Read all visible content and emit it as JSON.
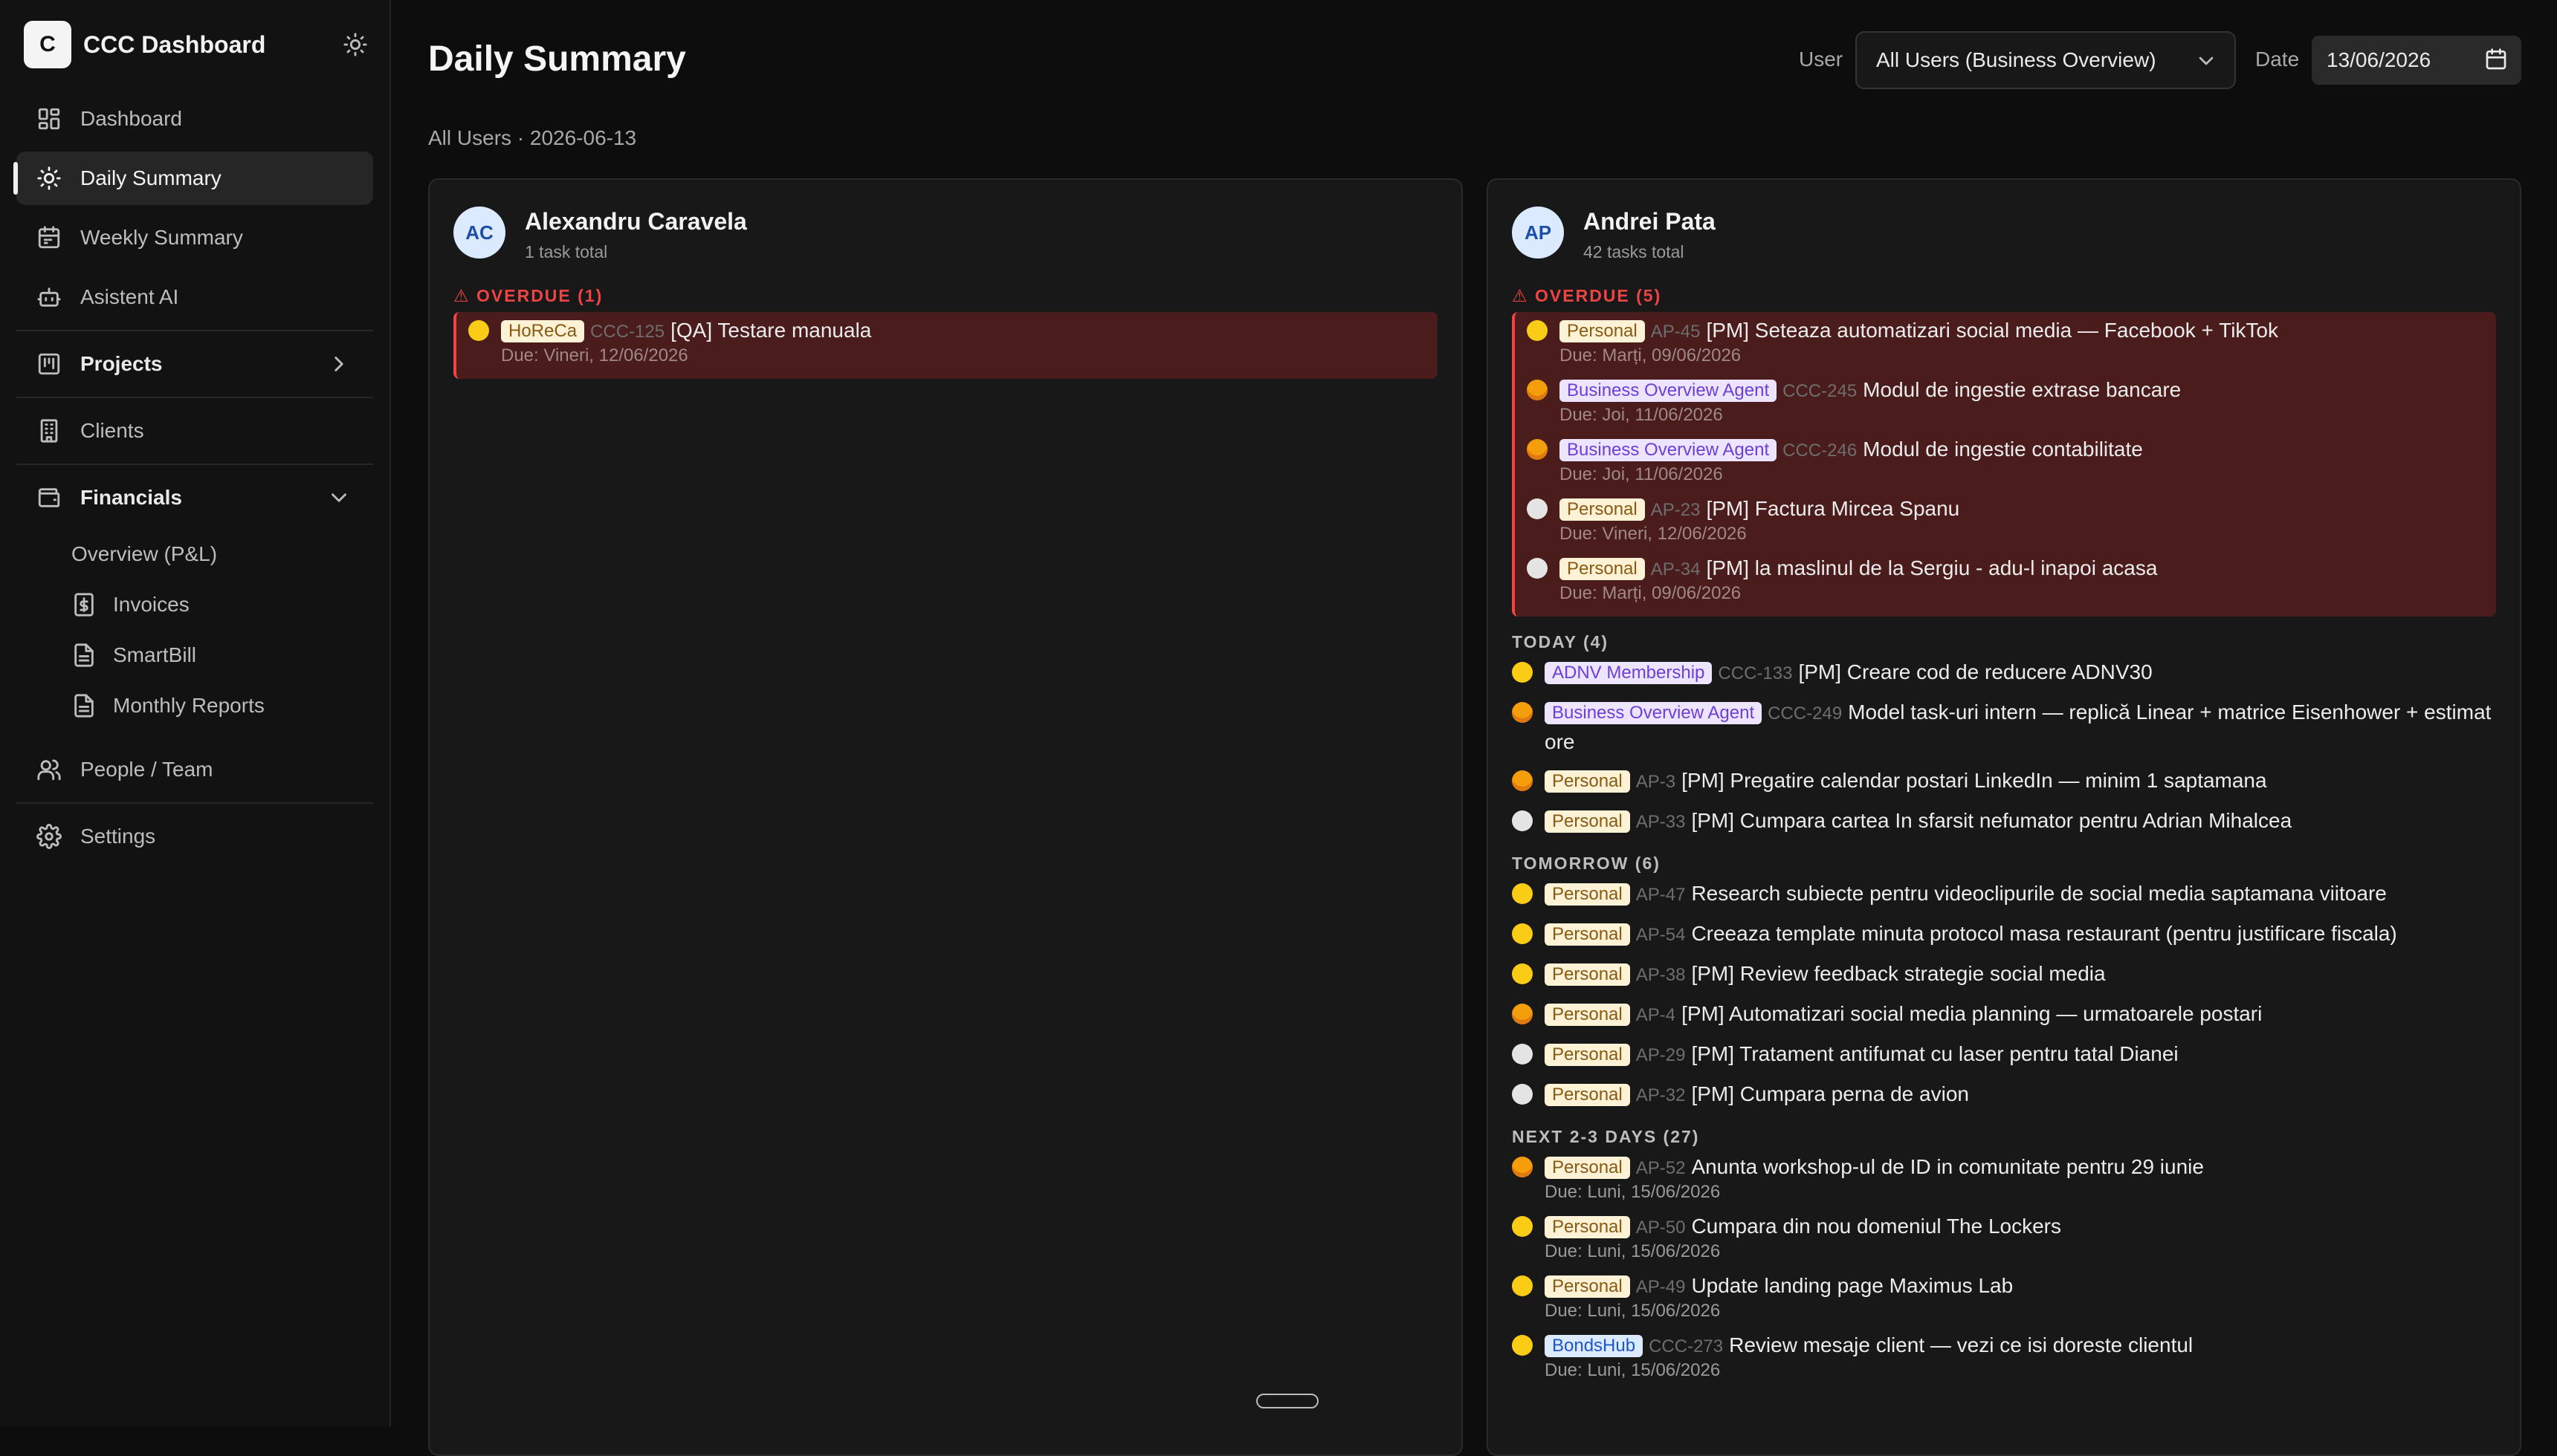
{
  "app": {
    "logo_letter": "C",
    "title": "CCC Dashboard"
  },
  "sidebar": {
    "items": [
      {
        "label": "Dashboard",
        "icon": "grid-icon"
      },
      {
        "label": "Daily Summary",
        "icon": "sun-icon",
        "active": true
      },
      {
        "label": "Weekly Summary",
        "icon": "calendar-icon"
      },
      {
        "label": "Asistent AI",
        "icon": "bot-icon"
      },
      {
        "label": "Projects",
        "icon": "kanban-icon"
      },
      {
        "label": "Clients",
        "icon": "building-icon"
      },
      {
        "label": "Financials",
        "icon": "wallet-icon"
      },
      {
        "label": "People / Team",
        "icon": "users-icon"
      },
      {
        "label": "Settings",
        "icon": "gear-icon"
      }
    ],
    "financials_sub": [
      {
        "label": "Overview (P&L)"
      },
      {
        "label": "Invoices",
        "icon": "dollar-doc-icon"
      },
      {
        "label": "SmartBill",
        "icon": "doc-icon"
      },
      {
        "label": "Monthly Reports",
        "icon": "doc-icon"
      }
    ]
  },
  "header": {
    "title": "Daily Summary",
    "user_label": "User",
    "user_value": "All Users (Business Overview)",
    "date_label": "Date",
    "date_value": "13/06/2026",
    "subtitle": "All Users · 2026-06-13"
  },
  "users": [
    {
      "initials": "AC",
      "name": "Alexandru Caravela",
      "count": "1 task total",
      "groups": [
        {
          "label": "⚠ OVERDUE (1)",
          "type": "overdue",
          "tasks": [
            {
              "dot": "yellow",
              "tag": "HoReCa",
              "tag_style": "horeca",
              "id": "CCC-125",
              "title": "[QA] Testare manuala",
              "due": "Due: Vineri, 12/06/2026"
            }
          ]
        }
      ]
    },
    {
      "initials": "AP",
      "name": "Andrei Pata",
      "count": "42 tasks total",
      "groups": [
        {
          "label": "⚠ OVERDUE (5)",
          "type": "overdue",
          "tasks": [
            {
              "dot": "yellow",
              "tag": "Personal",
              "tag_style": "personal",
              "id": "AP-45",
              "title": "[PM] Seteaza automatizari social media — Facebook + TikTok",
              "due": "Due: Marți, 09/06/2026"
            },
            {
              "dot": "orange",
              "tag": "Business Overview Agent",
              "tag_style": "boa",
              "id": "CCC-245",
              "title": "Modul de ingestie extrase bancare",
              "due": "Due: Joi, 11/06/2026"
            },
            {
              "dot": "orange",
              "tag": "Business Overview Agent",
              "tag_style": "boa",
              "id": "CCC-246",
              "title": "Modul de ingestie contabilitate",
              "due": "Due: Joi, 11/06/2026"
            },
            {
              "dot": "white",
              "tag": "Personal",
              "tag_style": "personal",
              "id": "AP-23",
              "title": "[PM] Factura Mircea Spanu",
              "due": "Due: Vineri, 12/06/2026"
            },
            {
              "dot": "white",
              "tag": "Personal",
              "tag_style": "personal",
              "id": "AP-34",
              "title": "[PM] la maslinul de la Sergiu - adu-l inapoi acasa",
              "due": "Due: Marți, 09/06/2026"
            }
          ]
        },
        {
          "label": "TODAY (4)",
          "type": "normal",
          "tasks": [
            {
              "dot": "yellow",
              "tag": "ADNV Membership",
              "tag_style": "adnv",
              "id": "CCC-133",
              "title": "[PM] Creare cod de reducere ADNV30"
            },
            {
              "dot": "orange",
              "tag": "Business Overview Agent",
              "tag_style": "boa",
              "id": "CCC-249",
              "title": "Model task-uri intern — replică Linear + matrice Eisenhower + estimat ore"
            },
            {
              "dot": "orange",
              "tag": "Personal",
              "tag_style": "personal",
              "id": "AP-3",
              "title": "[PM] Pregatire calendar postari LinkedIn — minim 1 saptamana"
            },
            {
              "dot": "white",
              "tag": "Personal",
              "tag_style": "personal",
              "id": "AP-33",
              "title": "[PM] Cumpara cartea In sfarsit nefumator pentru Adrian Mihalcea"
            }
          ]
        },
        {
          "label": "TOMORROW (6)",
          "type": "normal",
          "tasks": [
            {
              "dot": "yellow",
              "tag": "Personal",
              "tag_style": "personal",
              "id": "AP-47",
              "title": "Research subiecte pentru videoclipurile de social media saptamana viitoare"
            },
            {
              "dot": "yellow",
              "tag": "Personal",
              "tag_style": "personal",
              "id": "AP-54",
              "title": "Creeaza template minuta protocol masa restaurant (pentru justificare fiscala)"
            },
            {
              "dot": "yellow",
              "tag": "Personal",
              "tag_style": "personal",
              "id": "AP-38",
              "title": "[PM] Review feedback strategie social media"
            },
            {
              "dot": "orange",
              "tag": "Personal",
              "tag_style": "personal",
              "id": "AP-4",
              "title": "[PM] Automatizari social media planning — urmatoarele postari"
            },
            {
              "dot": "white",
              "tag": "Personal",
              "tag_style": "personal",
              "id": "AP-29",
              "title": "[PM] Tratament antifumat cu laser pentru tatal Dianei"
            },
            {
              "dot": "white",
              "tag": "Personal",
              "tag_style": "personal",
              "id": "AP-32",
              "title": "[PM] Cumpara perna de avion"
            }
          ]
        },
        {
          "label": "NEXT 2-3 DAYS (27)",
          "type": "normal",
          "tasks": [
            {
              "dot": "orange",
              "tag": "Personal",
              "tag_style": "personal",
              "id": "AP-52",
              "title": "Anunta workshop-ul de ID in comunitate pentru 29 iunie",
              "due": "Due: Luni, 15/06/2026"
            },
            {
              "dot": "yellow",
              "tag": "Personal",
              "tag_style": "personal",
              "id": "AP-50",
              "title": "Cumpara din nou domeniul The Lockers",
              "due": "Due: Luni, 15/06/2026"
            },
            {
              "dot": "yellow",
              "tag": "Personal",
              "tag_style": "personal",
              "id": "AP-49",
              "title": "Update landing page Maximus Lab",
              "due": "Due: Luni, 15/06/2026"
            },
            {
              "dot": "yellow",
              "tag": "BondsHub",
              "tag_style": "bonds",
              "id": "CCC-273",
              "title": "Review mesaje client — vezi ce isi doreste clientul",
              "due": "Due: Luni, 15/06/2026"
            }
          ]
        }
      ]
    }
  ],
  "colors": {
    "overdue_red": "#ef4444",
    "overdue_bg": "#4a1c1c",
    "accent": "#f4f4f4"
  }
}
